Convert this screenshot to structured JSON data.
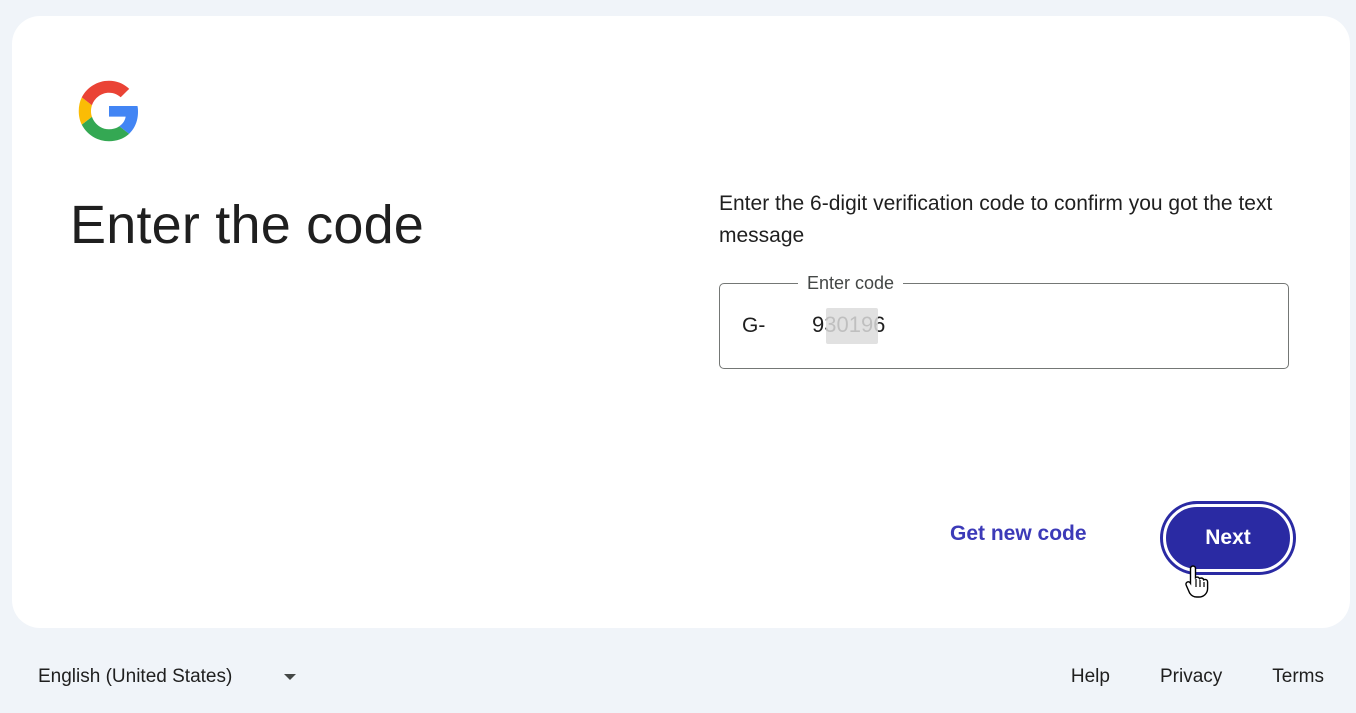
{
  "page": {
    "title": "Enter the code",
    "instructions": "Enter the 6-digit verification code to confirm you got the text message"
  },
  "code_field": {
    "label": "Enter code",
    "prefix": "G-",
    "value": "930196"
  },
  "actions": {
    "get_new_code": "Get new code",
    "next": "Next"
  },
  "footer": {
    "language": "English (United States)",
    "help": "Help",
    "privacy": "Privacy",
    "terms": "Terms"
  },
  "colors": {
    "primary": "#2a2aa3",
    "link": "#3c3ab8",
    "background": "#f0f4f9",
    "card": "#ffffff"
  },
  "icons": [
    "google-logo-icon",
    "chevron-down-icon",
    "hand-cursor-icon"
  ]
}
